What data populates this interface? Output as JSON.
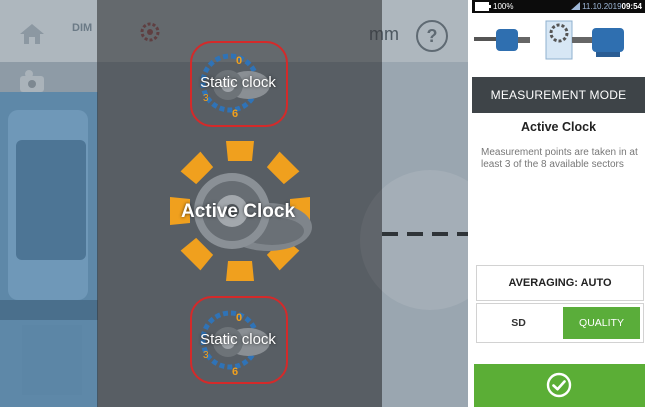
{
  "topbar": {
    "home_icon": "home-icon",
    "dim_label": "DIM",
    "unit": "mm",
    "help_label": "?"
  },
  "mode_selector": {
    "options": [
      {
        "label": "Static clock",
        "selected": false
      },
      {
        "label": "Active Clock",
        "selected": true
      },
      {
        "label": "Static clock",
        "selected": false
      }
    ],
    "accent_color": "#f0a01e",
    "ring_color": "#d42a2a"
  },
  "status_bar": {
    "battery": "100%",
    "date": "11.10.2019",
    "time": "09:54"
  },
  "panel": {
    "header": "MEASUREMENT MODE",
    "mode_title": "Active Clock",
    "description": "Measurement points are taken in at least 3 of the 8 available sectors",
    "averaging_label": "AVERAGING: AUTO",
    "sd_label": "SD",
    "quality_label": "QUALITY",
    "confirm_icon": "checkmark-circle-icon",
    "accent_green": "#5aad3a"
  }
}
